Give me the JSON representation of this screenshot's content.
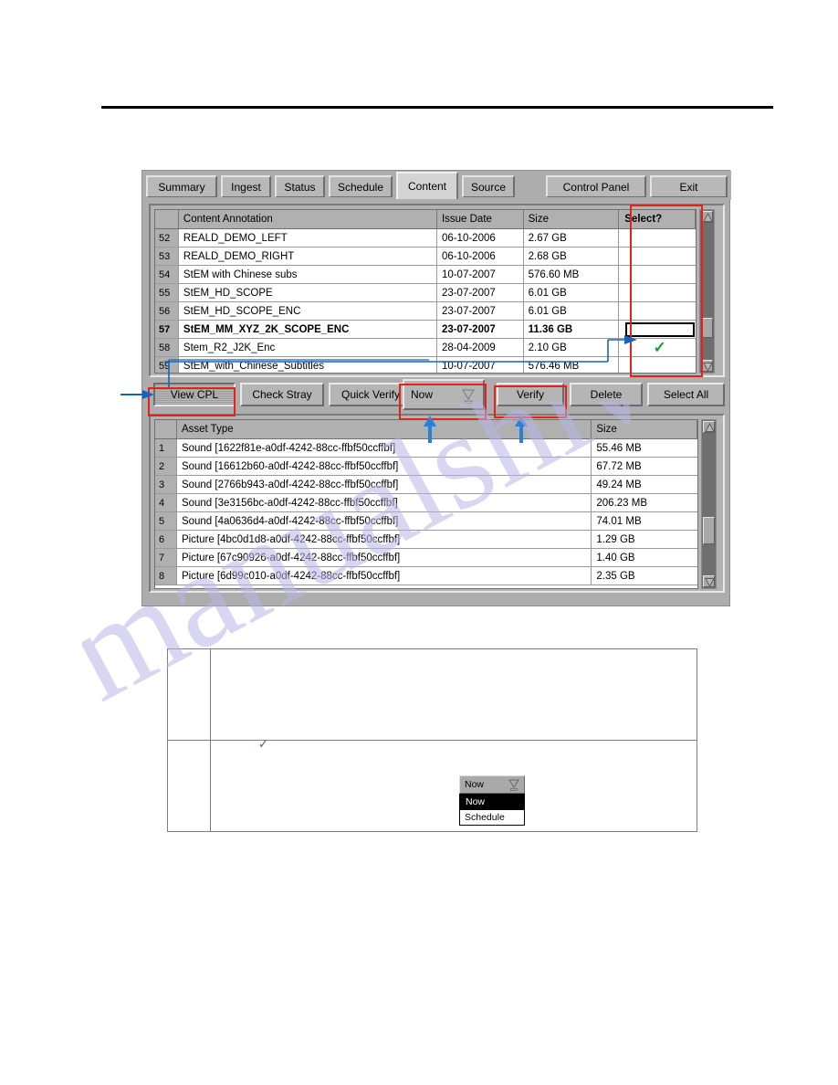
{
  "app": {
    "tabs": [
      {
        "label": "Summary",
        "active": false
      },
      {
        "label": "Ingest",
        "active": false
      },
      {
        "label": "Status",
        "active": false
      },
      {
        "label": "Schedule",
        "active": false
      },
      {
        "label": "Content",
        "active": true
      },
      {
        "label": "Source",
        "active": false
      }
    ],
    "right_buttons": [
      {
        "label": "Control Panel"
      },
      {
        "label": "Exit"
      }
    ]
  },
  "content_grid": {
    "headers": [
      "",
      "Content Annotation",
      "Issue Date",
      "Size",
      "Select?"
    ],
    "rows": [
      {
        "index": "52",
        "annotation": "REALD_DEMO_LEFT",
        "issue_date": "06-10-2006",
        "size": "2.67 GB",
        "select": "",
        "selected": false
      },
      {
        "index": "53",
        "annotation": "REALD_DEMO_RIGHT",
        "issue_date": "06-10-2006",
        "size": "2.68 GB",
        "select": "",
        "selected": false
      },
      {
        "index": "54",
        "annotation": "StEM with Chinese subs",
        "issue_date": "10-07-2007",
        "size": "576.60 MB",
        "select": "",
        "selected": false
      },
      {
        "index": "55",
        "annotation": "StEM_HD_SCOPE",
        "issue_date": "23-07-2007",
        "size": "6.01 GB",
        "select": "",
        "selected": false
      },
      {
        "index": "56",
        "annotation": "StEM_HD_SCOPE_ENC",
        "issue_date": "23-07-2007",
        "size": "6.01 GB",
        "select": "",
        "selected": false
      },
      {
        "index": "57",
        "annotation": "StEM_MM_XYZ_2K_SCOPE_ENC",
        "issue_date": "23-07-2007",
        "size": "11.36 GB",
        "select": "focus",
        "selected": true
      },
      {
        "index": "58",
        "annotation": "Stem_R2_J2K_Enc",
        "issue_date": "28-04-2009",
        "size": "2.10 GB",
        "select": "check",
        "selected": false
      },
      {
        "index": "59",
        "annotation": "StEM_with_Chinese_Subtitles",
        "issue_date": "10-07-2007",
        "size": "576.46 MB",
        "select": "",
        "selected": false
      }
    ]
  },
  "toolbar": {
    "view_cpl": "View CPL",
    "check_stray": "Check Stray",
    "quick_verify": "Quick Verify",
    "schedule_combo_value": "Now",
    "verify": "Verify",
    "delete": "Delete",
    "select_all": "Select All"
  },
  "asset_grid": {
    "headers": [
      "",
      "Asset Type",
      "Size"
    ],
    "rows": [
      {
        "index": "1",
        "asset_type": "Sound [1622f81e-a0df-4242-88cc-ffbf50ccffbf]",
        "size": "55.46 MB"
      },
      {
        "index": "2",
        "asset_type": "Sound [16612b60-a0df-4242-88cc-ffbf50ccffbf]",
        "size": "67.72 MB"
      },
      {
        "index": "3",
        "asset_type": "Sound [2766b943-a0df-4242-88cc-ffbf50ccffbf]",
        "size": "49.24 MB"
      },
      {
        "index": "4",
        "asset_type": "Sound [3e3156bc-a0df-4242-88cc-ffbf50ccffbf]",
        "size": "206.23 MB"
      },
      {
        "index": "5",
        "asset_type": "Sound [4a0636d4-a0df-4242-88cc-ffbf50ccffbf]",
        "size": "74.01 MB"
      },
      {
        "index": "6",
        "asset_type": "Picture [4bc0d1d8-a0df-4242-88cc-ffbf50ccffbf]",
        "size": "1.29 GB"
      },
      {
        "index": "7",
        "asset_type": "Picture [67c90926-a0df-4242-88cc-ffbf50ccffbf]",
        "size": "1.40 GB"
      },
      {
        "index": "8",
        "asset_type": "Picture [6d99c010-a0df-4242-88cc-ffbf50ccffbf]",
        "size": "2.35 GB"
      }
    ]
  },
  "legend": {
    "dropdown": {
      "value": "Now",
      "options": [
        {
          "label": "Now",
          "selected": true
        },
        {
          "label": "Schedule",
          "selected": false
        }
      ]
    }
  },
  "watermark": {
    "text": "manualshive.com"
  },
  "colors": {
    "highlight_red": "#e2231a",
    "annotation_blue": "#1565c0",
    "check_green": "#12a12a",
    "window_gray": "#adadad"
  }
}
